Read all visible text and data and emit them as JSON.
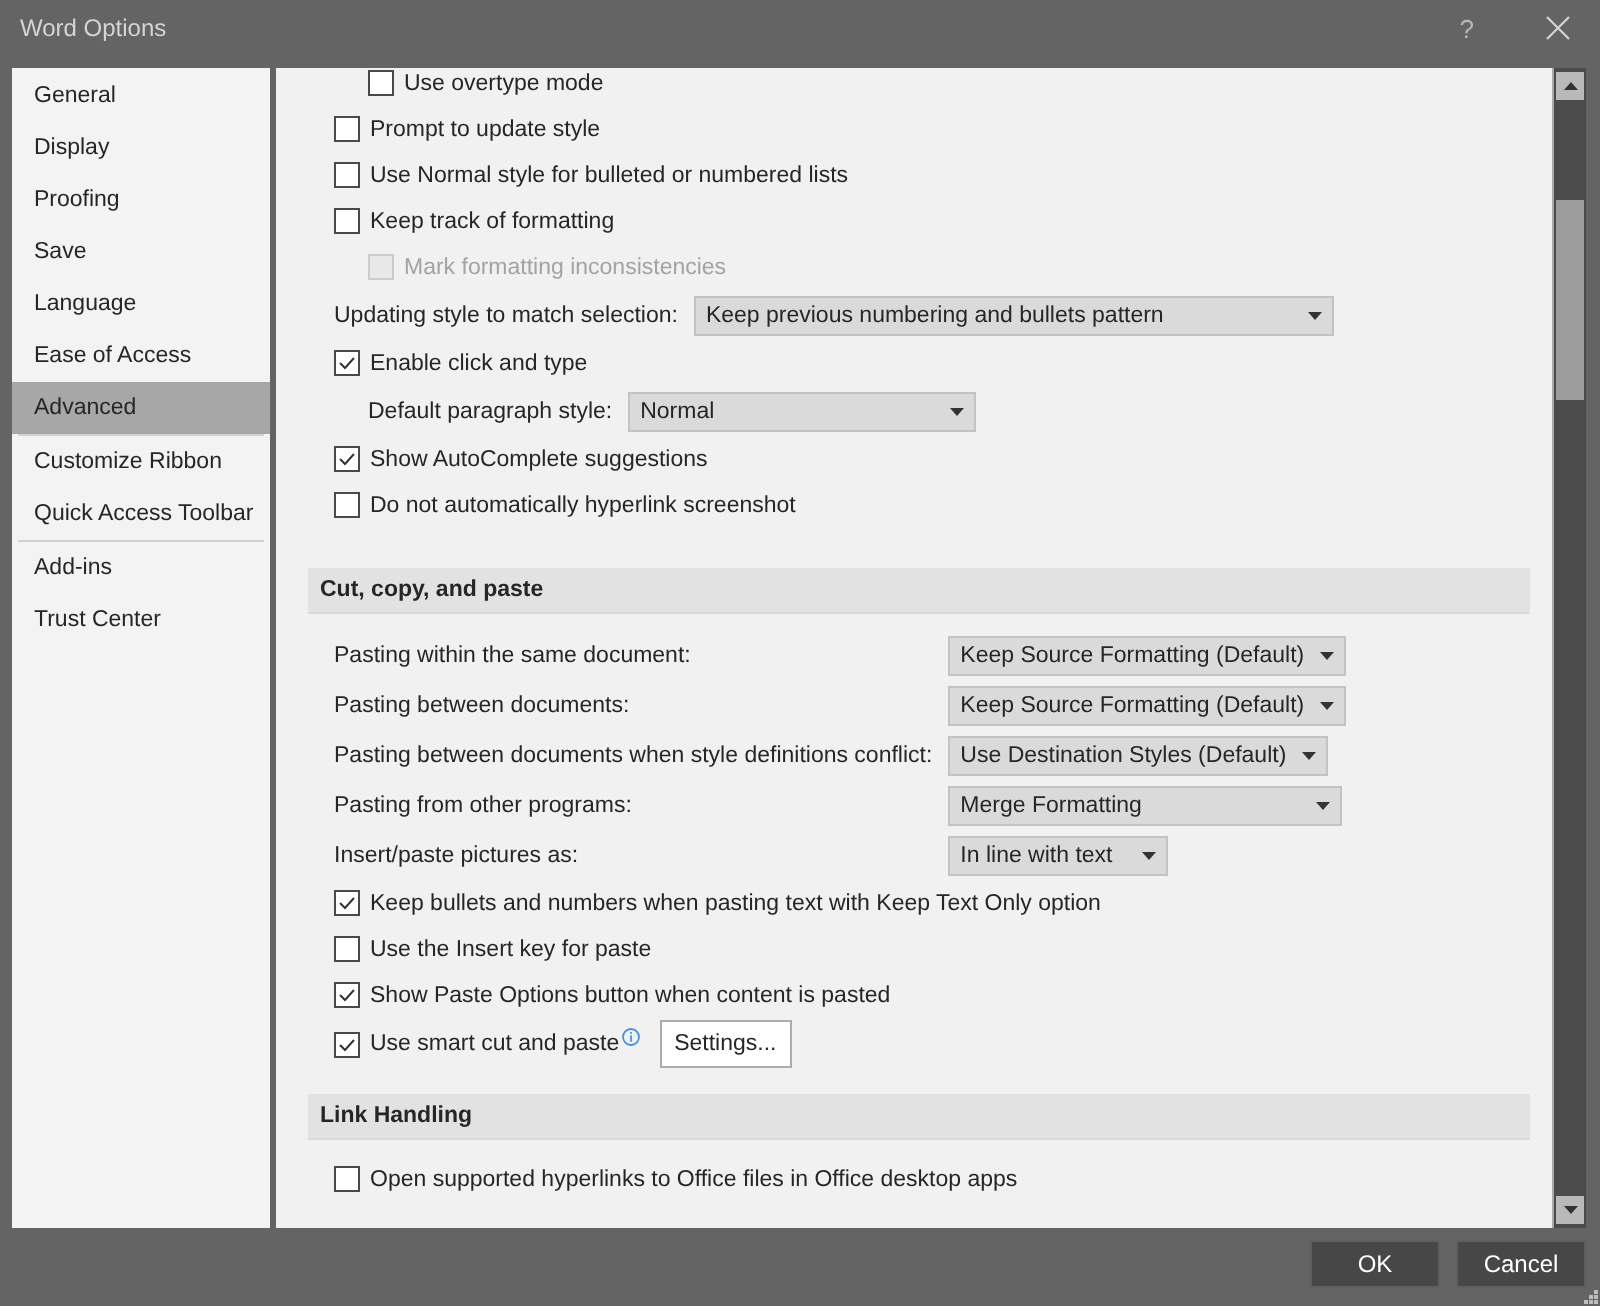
{
  "window": {
    "title": "Word Options",
    "help": "?"
  },
  "sidebar": {
    "groups": [
      {
        "items": [
          {
            "label": "General",
            "selected": false
          },
          {
            "label": "Display",
            "selected": false
          },
          {
            "label": "Proofing",
            "selected": false
          },
          {
            "label": "Save",
            "selected": false
          },
          {
            "label": "Language",
            "selected": false
          },
          {
            "label": "Ease of Access",
            "selected": false
          },
          {
            "label": "Advanced",
            "selected": true
          }
        ]
      },
      {
        "items": [
          {
            "label": "Customize Ribbon",
            "selected": false
          },
          {
            "label": "Quick Access Toolbar",
            "selected": false
          }
        ]
      },
      {
        "items": [
          {
            "label": "Add-ins",
            "selected": false
          },
          {
            "label": "Trust Center",
            "selected": false
          }
        ]
      }
    ]
  },
  "sections": [
    {
      "rows": [
        {
          "kind": "continued",
          "children": [
            {
              "kind": "checkbox",
              "label": "Use overtype mode",
              "checked": false,
              "disabled": false
            }
          ]
        },
        {
          "kind": "checkbox",
          "label": "Prompt to update style",
          "checked": false,
          "disabled": false
        },
        {
          "kind": "checkbox",
          "label": "Use Normal style for bulleted or numbered lists",
          "checked": false,
          "disabled": false
        },
        {
          "kind": "checkbox",
          "label": "Keep track of formatting",
          "checked": false,
          "disabled": false,
          "children": [
            {
              "kind": "checkbox",
              "label": "Mark formatting inconsistencies",
              "checked": false,
              "disabled": true
            }
          ]
        },
        {
          "kind": "select",
          "label": "Updating style to match selection:",
          "value": "Keep previous numbering and bullets pattern"
        },
        {
          "kind": "checkbox",
          "label": "Enable click and type",
          "checked": true,
          "disabled": false,
          "children": [
            {
              "kind": "select",
              "label": "Default paragraph style:",
              "value": "Normal"
            }
          ]
        },
        {
          "kind": "checkbox",
          "label": "Show AutoComplete suggestions",
          "checked": true,
          "disabled": false
        },
        {
          "kind": "checkbox",
          "label": "Do not automatically hyperlink screenshot",
          "checked": false,
          "disabled": false
        }
      ]
    },
    {
      "heading": "Cut, copy, and paste",
      "rows": [
        {
          "kind": "select",
          "label": "Pasting within the same document:",
          "value": "Keep Source Formatting (Default)"
        },
        {
          "kind": "select",
          "label": "Pasting between documents:",
          "value": "Keep Source Formatting (Default)"
        },
        {
          "kind": "select",
          "label": "Pasting between documents when style definitions conflict:",
          "value": "Use Destination Styles (Default)"
        },
        {
          "kind": "select",
          "label": "Pasting from other programs:",
          "value": "Merge Formatting"
        },
        {
          "kind": "select",
          "label": "Insert/paste pictures as:",
          "value": "In line with text"
        },
        {
          "kind": "checkbox",
          "label": "Keep bullets and numbers when pasting text with Keep Text Only option",
          "checked": true,
          "disabled": false
        },
        {
          "kind": "checkbox",
          "label": "Use the Insert key for paste",
          "checked": false,
          "disabled": false
        },
        {
          "kind": "checkbox",
          "label": "Show Paste Options button when content is pasted",
          "checked": true,
          "disabled": false
        },
        {
          "kind": "checkbox",
          "label": "Use smart cut and paste",
          "checked": true,
          "disabled": false,
          "info": true,
          "button": "Settings..."
        }
      ]
    },
    {
      "heading": "Link Handling",
      "rows": [
        {
          "kind": "checkbox",
          "label": "Open supported hyperlinks to Office files in Office desktop apps",
          "checked": false,
          "disabled": false
        }
      ]
    }
  ],
  "buttons": [
    {
      "label": "OK"
    },
    {
      "label": "Cancel"
    }
  ]
}
